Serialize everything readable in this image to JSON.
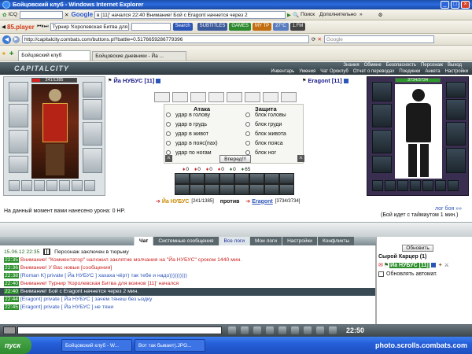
{
  "window": {
    "title": "Бойцовский клуб - Windows Internet Explorer",
    "minimize": "_",
    "maximize": "□",
    "close": "×"
  },
  "toolbar1": {
    "icq_label": "ICQ",
    "search_engine": "Google",
    "news_text": "в [11]' начался 22:40 Внимание! Бой с Eragont начнется через 2",
    "poisk": "Поиск",
    "dopolnitelno": "Дополнительно"
  },
  "toolbar2": {
    "player": "85.player",
    "track": "Турнир 'Королевская Битва для в",
    "search_label": "Search",
    "chips": [
      "SUBTITLES",
      "GAMES",
      "MY TP",
      "27°C",
      "1.FM"
    ]
  },
  "address": {
    "url": "http://capitalcity.combats.com/buttons.pl?battle=0.5176659286779396",
    "search_placeholder": "Google"
  },
  "tabs": [
    {
      "label": "Бойцовский клуб"
    },
    {
      "label": "Бойцовские дневники - Йа ..."
    }
  ],
  "game_nav": {
    "top": [
      "Знания",
      "Обмене",
      "Безопасность",
      "Персонаж",
      "Выход"
    ],
    "bottom": [
      "Инвентарь",
      "Умения",
      "Чат Ороклуб",
      "Отчет о переводах",
      "Поединки",
      "Анкета",
      "Настройки"
    ]
  },
  "logo": "CAPITALCITY",
  "player": {
    "name": "Йа НУБУС [11]",
    "hp": "241/1385",
    "hp_fraction": 0.174
  },
  "enemy": {
    "name": "Eragont [11]",
    "hp": "3734/3734",
    "hp_fraction": 1.0
  },
  "attack": {
    "header": "Атака",
    "options": [
      "удар в голову",
      "удар в грудь",
      "удар в живот",
      "удар в пояс(пах)",
      "удар по ногам"
    ]
  },
  "defense": {
    "header": "Защита",
    "options": [
      "блок головы",
      "блок груди",
      "блок живота",
      "блок пояса",
      "блок ног"
    ]
  },
  "forward_button": "Вперед!!!",
  "counters": [
    "0",
    "0",
    "0",
    "0",
    "0",
    "65"
  ],
  "fight_line": {
    "me": "Йа НУБУС",
    "me_hp": "[241/1385]",
    "vs": "против",
    "foe": "Eragont",
    "foe_hp": "[3734/3734]"
  },
  "damage_text": "На данный момент вами нанесено урона: 0 HP.",
  "battle_log_link": "лог боя »»",
  "timeout_text": "(Бой идет с таймаутом 1 мин.)",
  "chat_tabs": [
    "Чат",
    "Системные сообщения",
    "Все логи",
    "Мои логи",
    "Настройки",
    "Конфликты"
  ],
  "chat_lines": [
    {
      "time": "15.06.12 22:35",
      "text": "Персонаж заключен в тюрьму"
    },
    {
      "time": "22:35",
      "text": "Внимание! \"Комментатор\" наложил заклятие молчания на \"Йа НУБУС\" сроком 1440 мин."
    },
    {
      "time": "22:36",
      "text": "Внимание! У Вас новые [сообщения]"
    },
    {
      "time": "22:38",
      "text": "[Roman K] private [ Йа НУБУС ] хахаха чёрт) так тебе и надо))))))))))"
    },
    {
      "time": "22:40",
      "text": "Внимание! Турнир 'Королевская Битва для воинов [11]' начался"
    },
    {
      "time": "22:40",
      "text": "Внимание! Бой с Eragont начнется через 2 мин."
    },
    {
      "time": "22:44",
      "text": "[Eragont] private [ Йа НУБУС ] зачем тянеш без ыздку"
    },
    {
      "time": "22:45",
      "text": "[Eragont] private [ Йа НУБУС ] не тяни"
    }
  ],
  "side": {
    "refresh": "Обновить",
    "room": "Сырой Карцер (1)",
    "user": "Йа НУБУС [11]",
    "auto_label": "Обновлять автомат."
  },
  "clock": "22:50",
  "taskbar": {
    "start": "пуск",
    "items": [
      "Бойцовский клуб - W...",
      "Вот так бывает).JPG..."
    ],
    "watermark": "photo.scrolls.combats.com"
  }
}
